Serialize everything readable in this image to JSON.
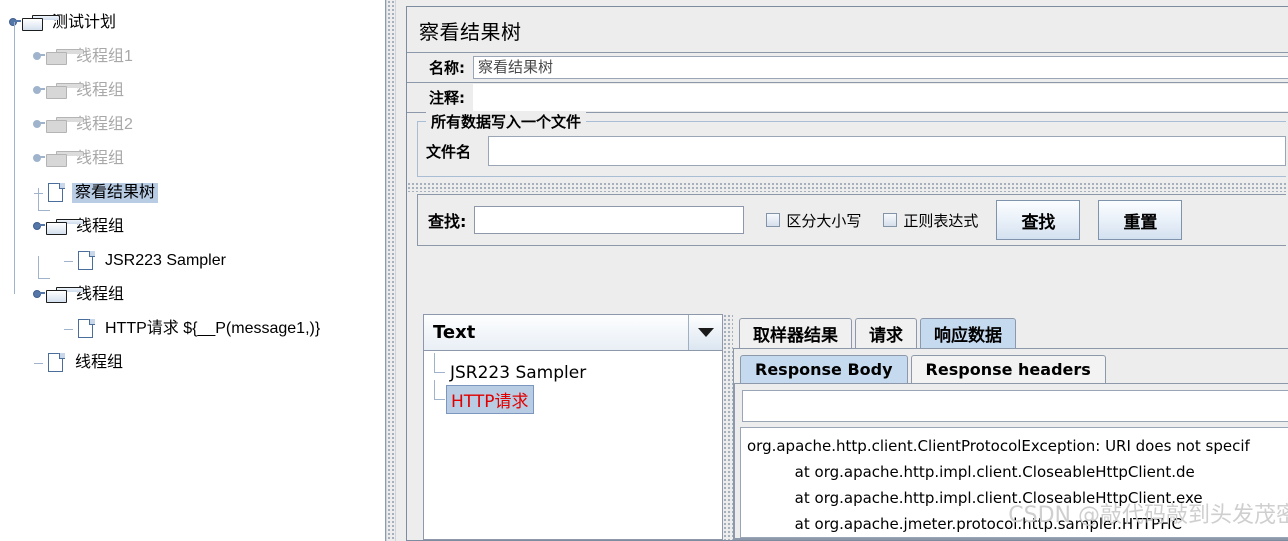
{
  "tree": {
    "nodes": [
      {
        "label": "测试计划",
        "icon": "folder-icon",
        "depth": 0,
        "state": "expanded",
        "dim": false,
        "selected": false
      },
      {
        "label": "线程组1",
        "icon": "folder-icon",
        "depth": 1,
        "state": "collapsed",
        "dim": true,
        "selected": false
      },
      {
        "label": "线程组",
        "icon": "folder-icon",
        "depth": 1,
        "state": "collapsed",
        "dim": true,
        "selected": false
      },
      {
        "label": "线程组2",
        "icon": "folder-icon",
        "depth": 1,
        "state": "collapsed",
        "dim": true,
        "selected": false
      },
      {
        "label": "线程组",
        "icon": "folder-icon",
        "depth": 1,
        "state": "collapsed",
        "dim": true,
        "selected": false
      },
      {
        "label": "察看结果树",
        "icon": "document-icon",
        "depth": 1,
        "state": "leaf",
        "dim": false,
        "selected": true
      },
      {
        "label": "线程组",
        "icon": "folder-icon",
        "depth": 1,
        "state": "expanded",
        "dim": false,
        "selected": false
      },
      {
        "label": "JSR223 Sampler",
        "icon": "document-icon",
        "depth": 2,
        "state": "leaf",
        "dim": false,
        "selected": false
      },
      {
        "label": "线程组",
        "icon": "folder-icon",
        "depth": 1,
        "state": "expanded",
        "dim": false,
        "selected": false
      },
      {
        "label": "HTTP请求 ${__P(message1,)}",
        "icon": "document-icon",
        "depth": 2,
        "state": "leaf",
        "dim": false,
        "selected": false
      },
      {
        "label": "线程组",
        "icon": "document-icon",
        "depth": 1,
        "state": "leaf",
        "dim": false,
        "selected": false
      }
    ]
  },
  "panel": {
    "title": "察看结果树",
    "name_label": "名称:",
    "name_value": "察看结果树",
    "comment_label": "注释:",
    "comment_value": "",
    "file_group_title": "所有数据写入一个文件",
    "filename_label": "文件名",
    "filename_value": ""
  },
  "search": {
    "label": "查找:",
    "value": "",
    "case_sensitive_label": "区分大小写",
    "case_sensitive_checked": false,
    "regex_label": "正则表达式",
    "regex_checked": false,
    "find_button": "查找",
    "reset_button": "重置"
  },
  "results": {
    "renderer_selected": "Text",
    "items": [
      {
        "label": "JSR223 Sampler",
        "error": false
      },
      {
        "label": "HTTP请求",
        "error": true
      }
    ]
  },
  "tabs": {
    "main": [
      {
        "label": "取样器结果",
        "active": false
      },
      {
        "label": "请求",
        "active": false
      },
      {
        "label": "响应数据",
        "active": true
      }
    ],
    "sub": [
      {
        "label": "Response Body",
        "active": true
      },
      {
        "label": "Response headers",
        "active": false
      }
    ]
  },
  "response": {
    "filter_value": "",
    "lines": [
      "org.apache.http.client.ClientProtocolException: URI does not specif",
      "          at org.apache.http.impl.client.CloseableHttpClient.de",
      "          at org.apache.http.impl.client.CloseableHttpClient.exe",
      "          at org.apache.jmeter.protocol.http.sampler.HTTPHC"
    ]
  },
  "watermark": "CSDN @敲代码敲到头发茂密",
  "colors": {
    "selection": "#b8cce4",
    "error_text": "#e00000",
    "tab_active": "#c5d9ef",
    "panel_bg": "#ededed",
    "border": "#8d99aa"
  }
}
